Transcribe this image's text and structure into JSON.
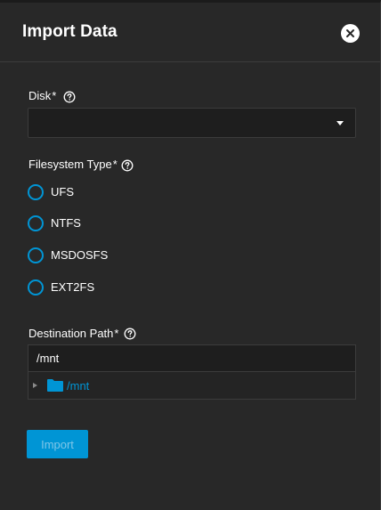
{
  "dialog": {
    "title": "Import Data",
    "close_icon": "close-icon"
  },
  "disk": {
    "label": "Disk",
    "required_mark": "*",
    "help_icon": "help-icon",
    "value": ""
  },
  "filesystem": {
    "label": "Filesystem Type",
    "required_mark": "*",
    "help_icon": "help-icon",
    "options": [
      {
        "label": "UFS",
        "selected": false
      },
      {
        "label": "NTFS",
        "selected": false
      },
      {
        "label": "MSDOSFS",
        "selected": false
      },
      {
        "label": "EXT2FS",
        "selected": false
      }
    ]
  },
  "destination": {
    "label": "Destination Path",
    "required_mark": "*",
    "help_icon": "help-icon",
    "value": "/mnt",
    "tree": {
      "node_label": "/mnt",
      "icon": "folder-icon",
      "expanded": false
    }
  },
  "actions": {
    "import_label": "Import",
    "import_enabled": false
  },
  "colors": {
    "accent": "#0095d5",
    "background": "#282828",
    "field_background": "#1e1e1e",
    "text": "#ffffff"
  }
}
